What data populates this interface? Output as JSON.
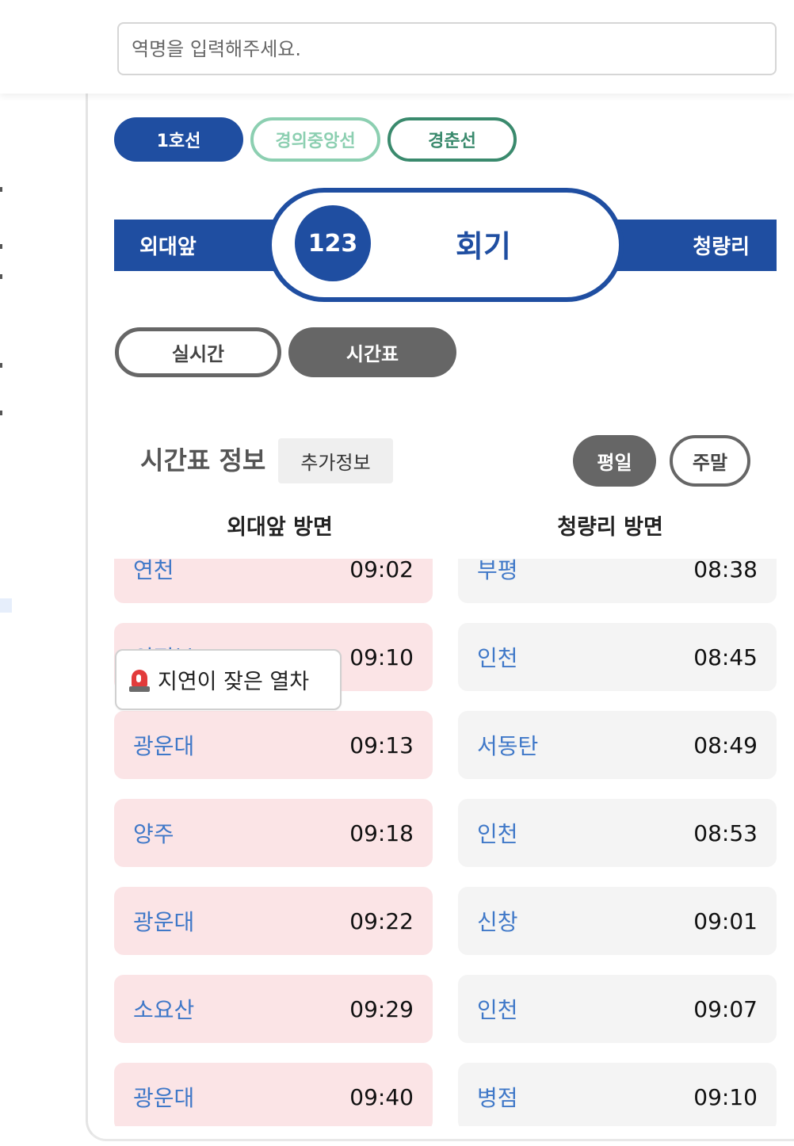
{
  "search": {
    "placeholder": "역명을 입력해주세요."
  },
  "lines": [
    {
      "label": "1호선",
      "color": "#1f4ea1",
      "active": true
    },
    {
      "label": "경의중앙선",
      "color": "#8ccfb1",
      "active": false
    },
    {
      "label": "경춘선",
      "color": "#3a8a6d",
      "active": false
    }
  ],
  "station": {
    "prev": "외대앞",
    "number": "123",
    "name": "회기",
    "next": "청량리"
  },
  "modes": {
    "realtime": "실시간",
    "timetable": "시간표",
    "active": "timetable"
  },
  "timetable": {
    "title": "시간표 정보",
    "extra_info": "추가정보",
    "weekday": "평일",
    "weekend": "주말",
    "active_day": "weekday"
  },
  "directions": {
    "left": {
      "header": "외대앞 방면",
      "rows": [
        {
          "dest": "연천",
          "time": "09:02"
        },
        {
          "dest": "의정부",
          "time": "09:10"
        },
        {
          "dest": "광운대",
          "time": "09:13"
        },
        {
          "dest": "양주",
          "time": "09:18"
        },
        {
          "dest": "광운대",
          "time": "09:22"
        },
        {
          "dest": "소요산",
          "time": "09:29"
        },
        {
          "dest": "광운대",
          "time": "09:40"
        }
      ]
    },
    "right": {
      "header": "청량리 방면",
      "rows": [
        {
          "dest": "부평",
          "time": "08:38"
        },
        {
          "dest": "인천",
          "time": "08:45"
        },
        {
          "dest": "서동탄",
          "time": "08:49"
        },
        {
          "dest": "인천",
          "time": "08:53"
        },
        {
          "dest": "신창",
          "time": "09:01"
        },
        {
          "dest": "인천",
          "time": "09:07"
        },
        {
          "dest": "병점",
          "time": "09:10"
        }
      ]
    }
  },
  "tooltip": {
    "icon": "siren-icon",
    "text": "지연이 잦은 열차"
  },
  "colors": {
    "primary": "#1f4ea1",
    "delay_row": "#fbe4e6",
    "normal_row": "#f4f4f4",
    "dest_text": "#3f78c8",
    "mode_active": "#666666"
  }
}
